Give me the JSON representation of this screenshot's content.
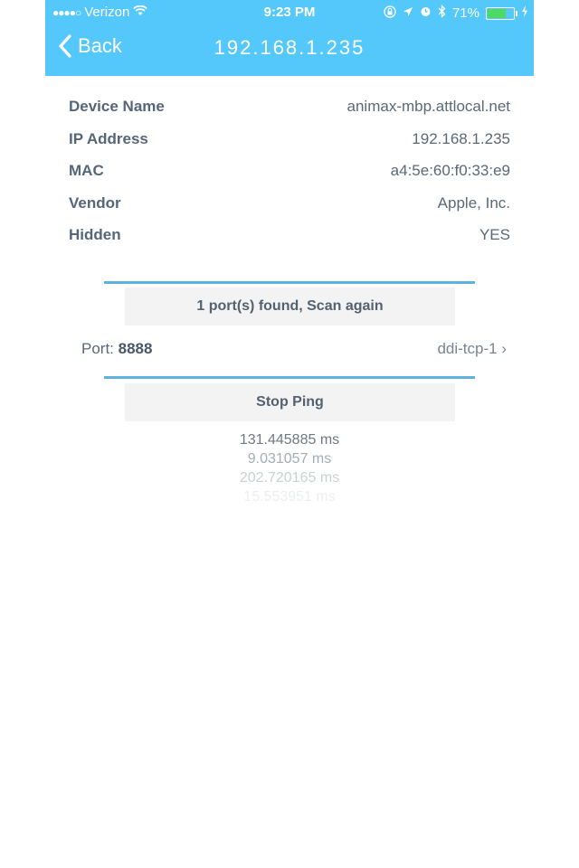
{
  "status_bar": {
    "signal": "●●●●○",
    "carrier": "Verizon",
    "time": "9:23 PM",
    "battery_percent": "71%",
    "battery_level": 0.71,
    "battery_color": "#4cd964"
  },
  "nav": {
    "back_label": "Back",
    "title": "192.168.1.235",
    "color": "#54c8fb"
  },
  "device": {
    "rows": [
      {
        "label": "Device Name",
        "value": "animax-mbp.attlocal.net"
      },
      {
        "label": "IP Address",
        "value": "192.168.1.235"
      },
      {
        "label": "MAC",
        "value": "a4:5e:60:f0:33:e9"
      },
      {
        "label": "Vendor",
        "value": "Apple, Inc."
      },
      {
        "label": "Hidden",
        "value": "YES"
      }
    ]
  },
  "scan": {
    "button_label": "1 port(s) found, Scan again"
  },
  "port": {
    "label": "Port:",
    "number": "8888",
    "service": "ddi-tcp-1",
    "chevron": "›"
  },
  "ping": {
    "button_label": "Stop Ping",
    "results": [
      "131.445885 ms",
      "9.031057 ms",
      "202.720165 ms",
      "15.553951 ms"
    ]
  }
}
